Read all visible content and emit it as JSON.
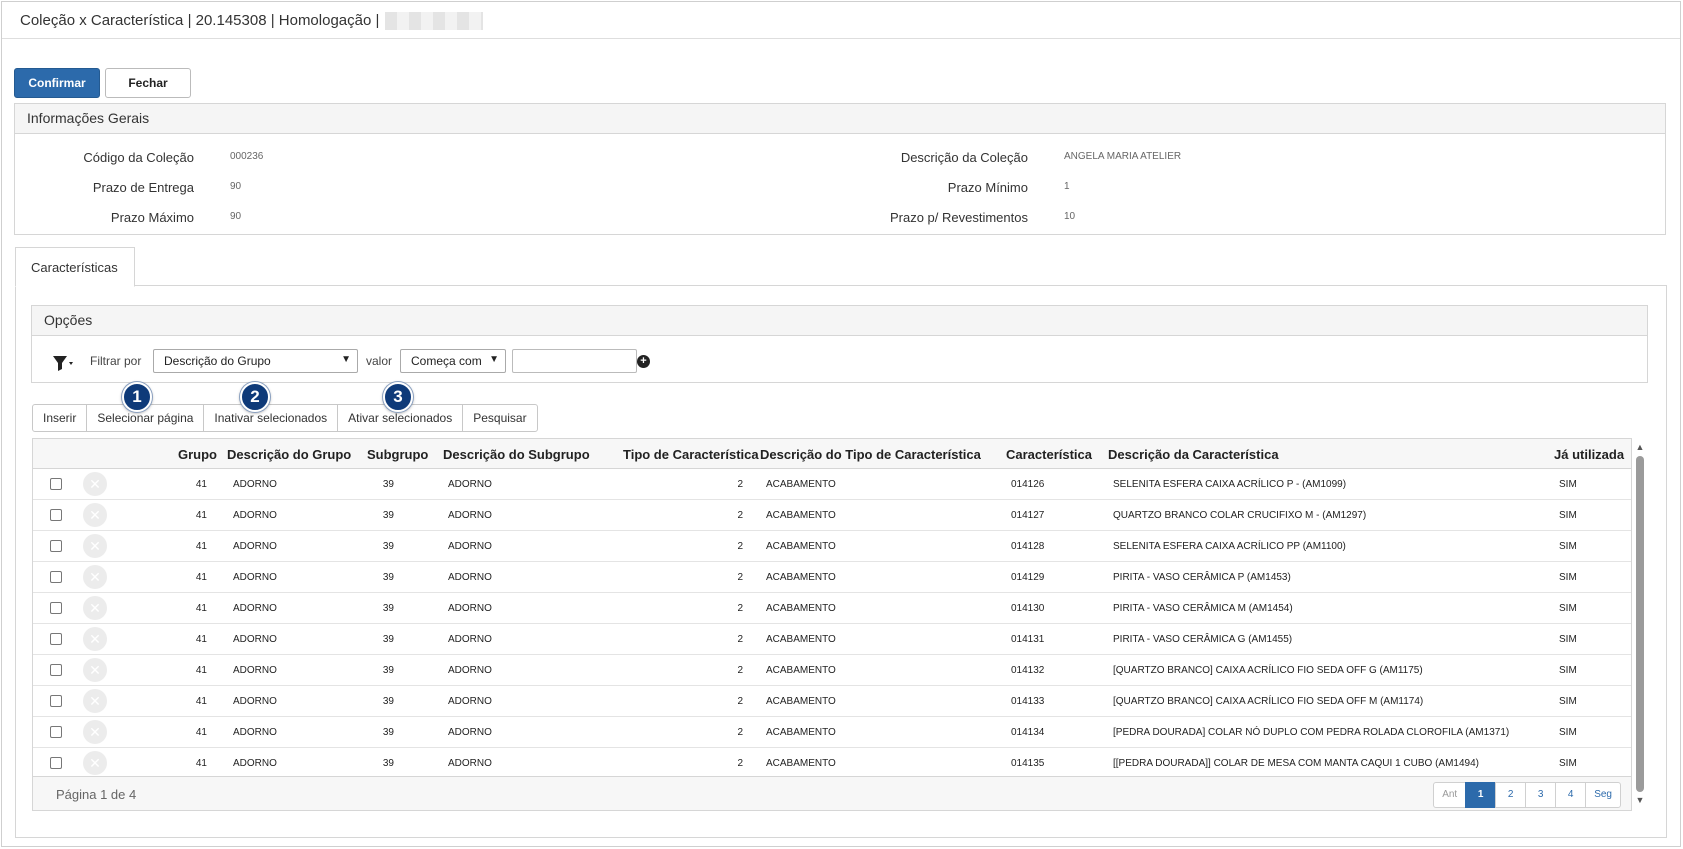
{
  "window": {
    "title": "Coleção x Característica | 20.145308 | Homologação |"
  },
  "actions": {
    "confirm_label": "Confirmar",
    "close_label": "Fechar"
  },
  "general_info": {
    "title": "Informações Gerais",
    "fields": {
      "collection_code_label": "Código da Coleção",
      "collection_code_value": "000236",
      "delivery_term_label": "Prazo de Entrega",
      "delivery_term_value": "90",
      "max_term_label": "Prazo Máximo",
      "max_term_value": "90",
      "collection_desc_label": "Descrição da Coleção",
      "collection_desc_value": "ANGELA MARIA ATELIER",
      "min_term_label": "Prazo Mínimo",
      "min_term_value": "1",
      "coating_term_label": "Prazo p/ Revestimentos",
      "coating_term_value": "10"
    }
  },
  "tabs": [
    {
      "label": "Características",
      "active": true
    }
  ],
  "options": {
    "title": "Opções",
    "filter_by_label": "Filtrar por",
    "filter_by_selected": "Descrição do Grupo",
    "value_label": "valor",
    "operator_selected": "Começa com",
    "value_input": ""
  },
  "toolbar": {
    "insert": "Inserir",
    "select_page": "Selecionar página",
    "deactivate_selected": "Inativar selecionados",
    "activate_selected": "Ativar selecionados",
    "search": "Pesquisar"
  },
  "callouts": [
    "1",
    "2",
    "3"
  ],
  "table": {
    "columns": {
      "group": "Grupo",
      "group_desc": "Descrição do Grupo",
      "subgroup": "Subgrupo",
      "subgroup_desc": "Descrição do Subgrupo",
      "char_type": "Tipo de Característica",
      "char_type_desc": "Descrição do Tipo de Característica",
      "characteristic": "Característica",
      "char_desc": "Descrição da Característica",
      "used": "Já utilizada"
    },
    "rows": [
      {
        "group": "41",
        "group_desc": "ADORNO",
        "subgroup": "39",
        "subgroup_desc": "ADORNO",
        "char_type": "2",
        "char_type_desc": "ACABAMENTO",
        "characteristic": "014126",
        "char_desc": "SELENITA ESFERA CAIXA ACRÍLICO P - (AM1099)",
        "used": "SIM"
      },
      {
        "group": "41",
        "group_desc": "ADORNO",
        "subgroup": "39",
        "subgroup_desc": "ADORNO",
        "char_type": "2",
        "char_type_desc": "ACABAMENTO",
        "characteristic": "014127",
        "char_desc": "QUARTZO BRANCO COLAR CRUCIFIXO M - (AM1297)",
        "used": "SIM"
      },
      {
        "group": "41",
        "group_desc": "ADORNO",
        "subgroup": "39",
        "subgroup_desc": "ADORNO",
        "char_type": "2",
        "char_type_desc": "ACABAMENTO",
        "characteristic": "014128",
        "char_desc": "SELENITA ESFERA CAIXA ACRÍLICO PP (AM1100)",
        "used": "SIM"
      },
      {
        "group": "41",
        "group_desc": "ADORNO",
        "subgroup": "39",
        "subgroup_desc": "ADORNO",
        "char_type": "2",
        "char_type_desc": "ACABAMENTO",
        "characteristic": "014129",
        "char_desc": "PIRITA - VASO CERÂMICA P (AM1453)",
        "used": "SIM"
      },
      {
        "group": "41",
        "group_desc": "ADORNO",
        "subgroup": "39",
        "subgroup_desc": "ADORNO",
        "char_type": "2",
        "char_type_desc": "ACABAMENTO",
        "characteristic": "014130",
        "char_desc": "PIRITA - VASO CERÂMICA M (AM1454)",
        "used": "SIM"
      },
      {
        "group": "41",
        "group_desc": "ADORNO",
        "subgroup": "39",
        "subgroup_desc": "ADORNO",
        "char_type": "2",
        "char_type_desc": "ACABAMENTO",
        "characteristic": "014131",
        "char_desc": "PIRITA - VASO CERÂMICA G (AM1455)",
        "used": "SIM"
      },
      {
        "group": "41",
        "group_desc": "ADORNO",
        "subgroup": "39",
        "subgroup_desc": "ADORNO",
        "char_type": "2",
        "char_type_desc": "ACABAMENTO",
        "characteristic": "014132",
        "char_desc": "[QUARTZO BRANCO] CAIXA ACRÍLICO FIO SEDA OFF G (AM1175)",
        "used": "SIM"
      },
      {
        "group": "41",
        "group_desc": "ADORNO",
        "subgroup": "39",
        "subgroup_desc": "ADORNO",
        "char_type": "2",
        "char_type_desc": "ACABAMENTO",
        "characteristic": "014133",
        "char_desc": "[QUARTZO BRANCO] CAIXA ACRÍLICO FIO SEDA OFF M (AM1174)",
        "used": "SIM"
      },
      {
        "group": "41",
        "group_desc": "ADORNO",
        "subgroup": "39",
        "subgroup_desc": "ADORNO",
        "char_type": "2",
        "char_type_desc": "ACABAMENTO",
        "characteristic": "014134",
        "char_desc": "[PEDRA DOURADA] COLAR NÓ DUPLO COM PEDRA ROLADA CLOROFILA (AM1371)",
        "used": "SIM"
      },
      {
        "group": "41",
        "group_desc": "ADORNO",
        "subgroup": "39",
        "subgroup_desc": "ADORNO",
        "char_type": "2",
        "char_type_desc": "ACABAMENTO",
        "characteristic": "014135",
        "char_desc": "[[PEDRA DOURADA]] COLAR DE MESA COM MANTA CAQUI 1 CUBO (AM1494)",
        "used": "SIM"
      }
    ]
  },
  "pagination": {
    "summary": "Página 1 de 4",
    "prev": "Ant",
    "pages": [
      "1",
      "2",
      "3",
      "4"
    ],
    "current": "1",
    "next": "Seg"
  },
  "colors": {
    "primary": "#2c6aab",
    "callout": "#0e3a79"
  }
}
